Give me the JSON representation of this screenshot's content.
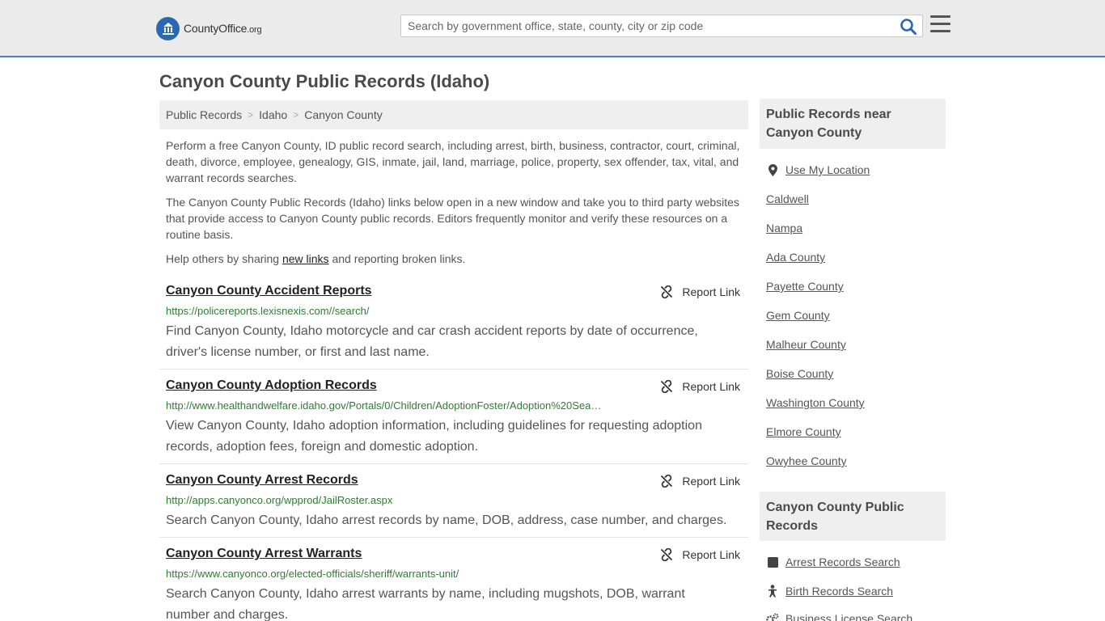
{
  "header": {
    "logo_main": "CountyOffice",
    "logo_suffix": ".org",
    "search_placeholder": "Search by government office, state, county, city or zip code"
  },
  "page": {
    "title": "Canyon County Public Records (Idaho)"
  },
  "breadcrumb": [
    "Public Records",
    "Idaho",
    "Canyon County"
  ],
  "intro": {
    "p1": "Perform a free Canyon County, ID public record search, including arrest, birth, business, contractor, court, criminal, death, divorce, employee, genealogy, GIS, inmate, jail, land, marriage, police, property, sex offender, tax, vital, and warrant records searches.",
    "p2": "The Canyon County Public Records (Idaho) links below open in a new window and take you to third party websites that provide access to Canyon County public records. Editors frequently monitor and verify these resources on a routine basis.",
    "p3_before": "Help others by sharing ",
    "p3_link": "new links",
    "p3_after": " and reporting broken links."
  },
  "records": [
    {
      "title": "Canyon County Accident Reports",
      "url": "https://policereports.lexisnexis.com//search/",
      "desc": "Find Canyon County, Idaho motorcycle and car crash accident reports by date of occurrence, driver's license number, or first and last name.",
      "report": "Report Link"
    },
    {
      "title": "Canyon County Adoption Records",
      "url": "http://www.healthandwelfare.idaho.gov/Portals/0/Children/AdoptionFoster/Adoption%20Sea…",
      "desc": "View Canyon County, Idaho adoption information, including guidelines for requesting adoption records, adoption fees, foreign and domestic adoption.",
      "report": "Report Link"
    },
    {
      "title": "Canyon County Arrest Records",
      "url": "http://apps.canyonco.org/wpprod/JailRoster.aspx",
      "desc": "Search Canyon County, Idaho arrest records by name, DOB, address, case number, and charges.",
      "report": "Report Link"
    },
    {
      "title": "Canyon County Arrest Warrants",
      "url": "https://www.canyonco.org/elected-officials/sheriff/warrants-unit/",
      "desc": "Search Canyon County, Idaho arrest warrants by name, including mugshots, DOB, warrant number and charges.",
      "report": "Report Link"
    }
  ],
  "sidebar": {
    "near_title": "Public Records near Canyon County",
    "use_location": "Use My Location",
    "near_links": [
      "Caldwell",
      "Nampa",
      "Ada County",
      "Payette County",
      "Gem County",
      "Malheur County",
      "Boise County",
      "Washington County",
      "Elmore County",
      "Owyhee County"
    ],
    "records_title": "Canyon County Public Records",
    "record_links": [
      "Arrest Records Search",
      "Birth Records Search",
      "Business License Search"
    ]
  },
  "colors": {
    "accent": "#2a68b1",
    "url_green": "#2e7d32",
    "header_bg": "#ebebeb"
  }
}
